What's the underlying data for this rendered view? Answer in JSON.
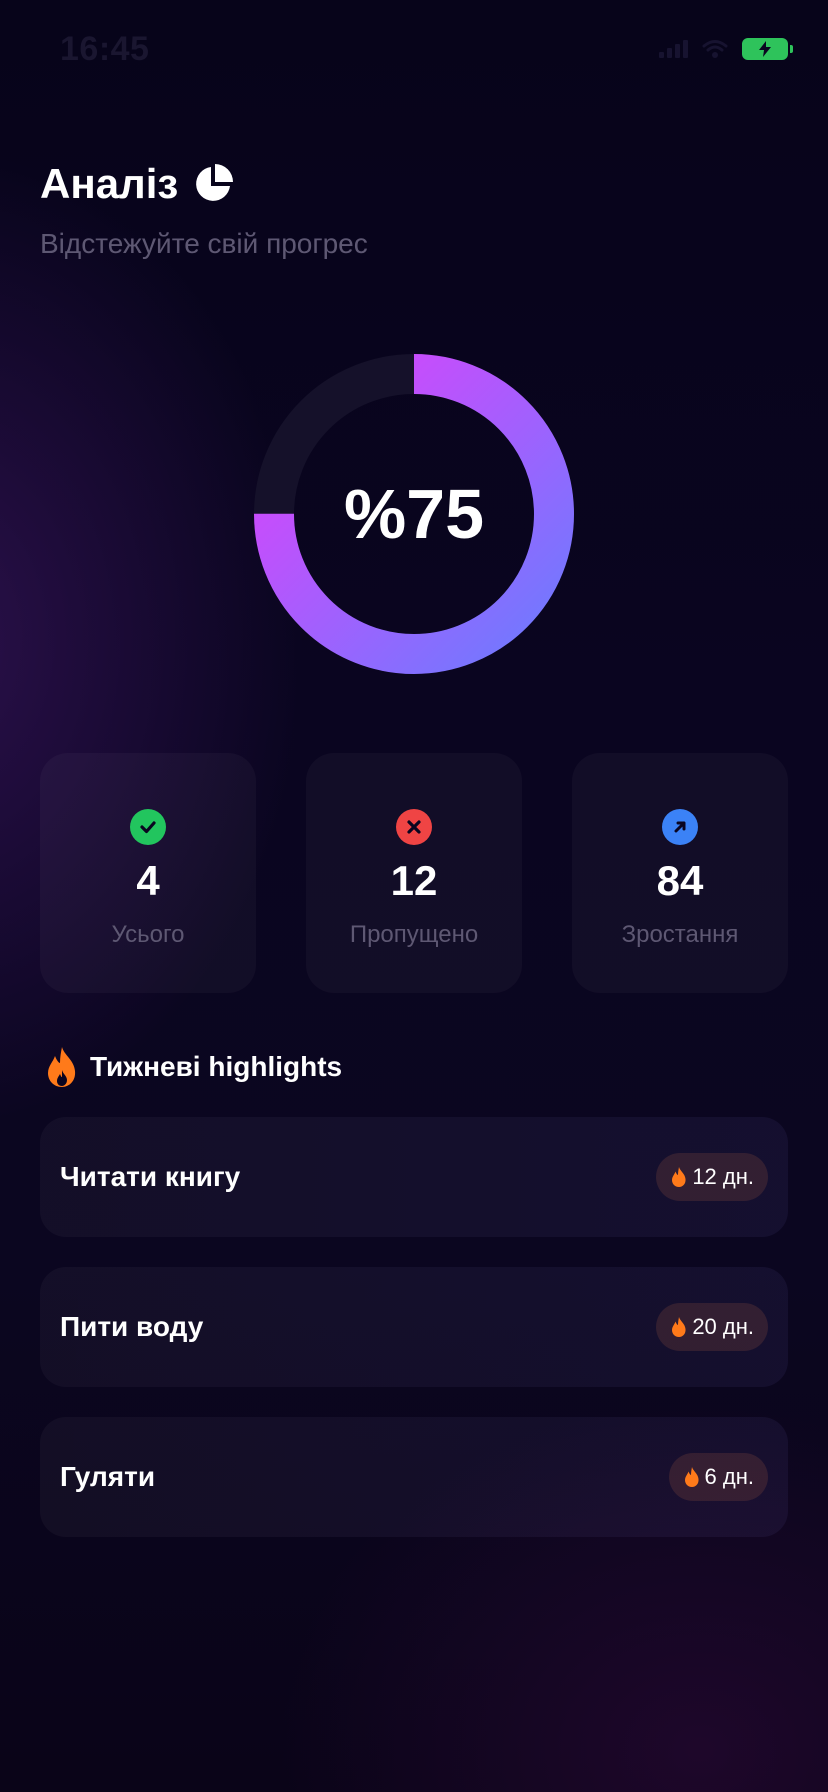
{
  "status": {
    "time": "16:45"
  },
  "header": {
    "title": "Аналіз",
    "subtitle": "Відстежуйте свій прогрес"
  },
  "progress": {
    "label": "%75",
    "value_percent": 75
  },
  "stats": [
    {
      "value": "4",
      "label": "Усього",
      "icon": "check-icon",
      "color": "#22c55e"
    },
    {
      "value": "12",
      "label": "Пропущено",
      "icon": "x-icon",
      "color": "#ef4444"
    },
    {
      "value": "84",
      "label": "Зростання",
      "icon": "arrow-up-right-icon",
      "color": "#3b82f6"
    }
  ],
  "highlights": {
    "title": "Тижневі highlights",
    "items": [
      {
        "name": "Читати книгу",
        "streak": "12 дн."
      },
      {
        "name": "Пити воду",
        "streak": "20 дн."
      },
      {
        "name": "Гуляти",
        "streak": "6 дн."
      }
    ]
  },
  "colors": {
    "ring_start": "#e040fb",
    "ring_end": "#6b7cff",
    "ring_track": "#15112a",
    "fire": "#ff7a1a"
  }
}
